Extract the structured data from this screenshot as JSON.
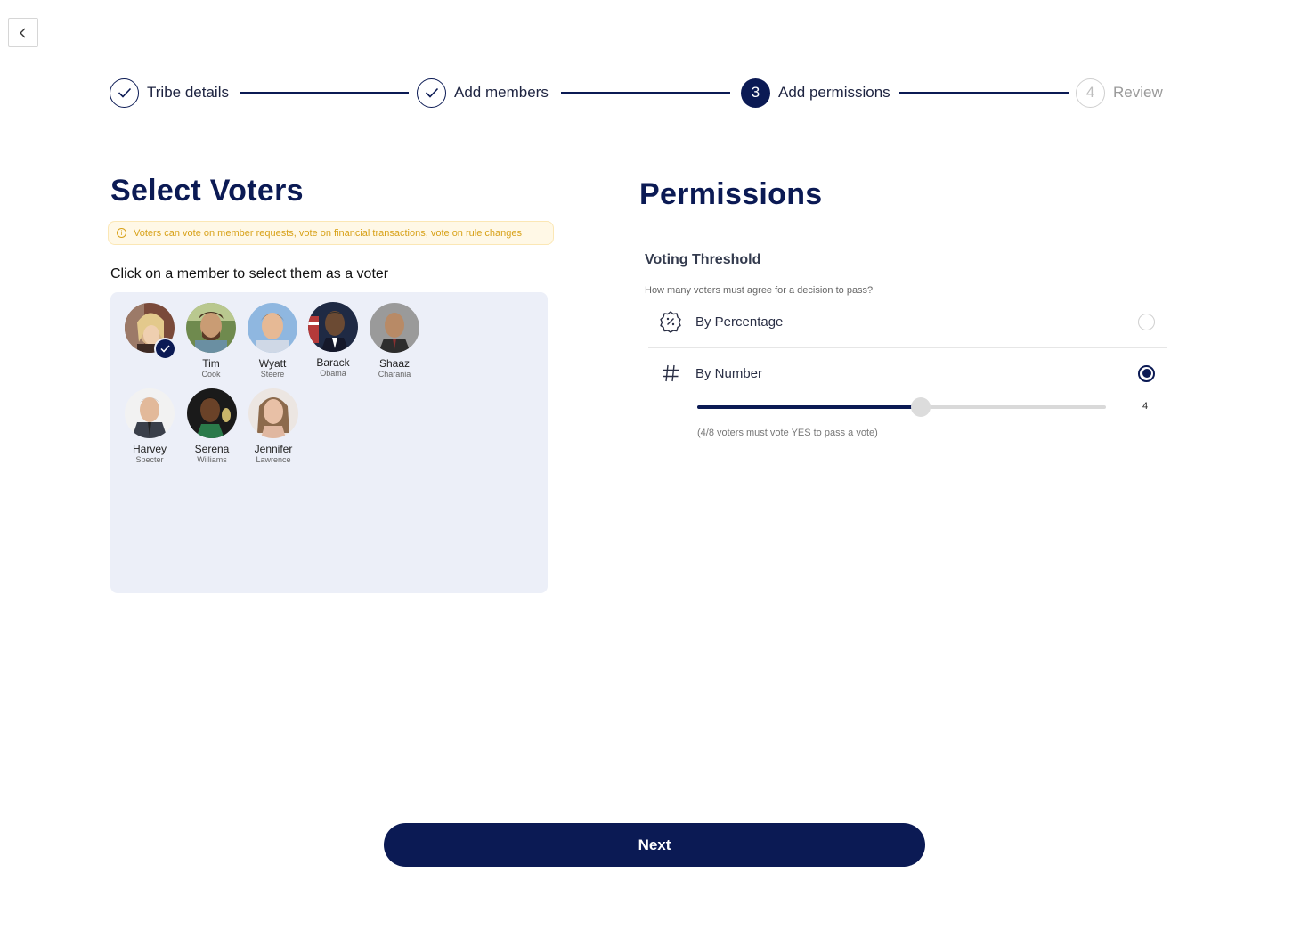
{
  "nav": {
    "back_icon": "chevron-left-icon"
  },
  "stepper": {
    "steps": [
      {
        "label": "Tribe details",
        "state": "done",
        "icon": "check-icon"
      },
      {
        "label": "Add members",
        "state": "done",
        "icon": "check-icon"
      },
      {
        "label": "Add permissions",
        "state": "active",
        "number": "3"
      },
      {
        "label": "Review",
        "state": "pending",
        "number": "4"
      }
    ]
  },
  "voters": {
    "title": "Select Voters",
    "notice": "Voters can vote on member requests, vote on financial transactions, vote on rule changes",
    "instruction": "Click on a member to select them as a voter",
    "members": [
      {
        "first": "",
        "last": "",
        "selected": true
      },
      {
        "first": "Tim",
        "last": "Cook",
        "selected": false
      },
      {
        "first": "Wyatt",
        "last": "Steere",
        "selected": false
      },
      {
        "first": "Barack",
        "last": "Obama",
        "selected": false
      },
      {
        "first": "Shaaz",
        "last": "Charania",
        "selected": false
      },
      {
        "first": "Harvey",
        "last": "Specter",
        "selected": false
      },
      {
        "first": "Serena",
        "last": "Williams",
        "selected": false
      },
      {
        "first": "Jennifer",
        "last": "Lawrence",
        "selected": false
      }
    ]
  },
  "permissions": {
    "title": "Permissions",
    "threshold_title": "Voting Threshold",
    "threshold_question": "How many voters must agree for a decision to pass?",
    "options": [
      {
        "label": "By Percentage",
        "icon": "percent-badge-icon",
        "selected": false
      },
      {
        "label": "By Number",
        "icon": "hash-icon",
        "selected": true
      }
    ],
    "slider": {
      "value": "4",
      "min": 0,
      "max": 8,
      "fraction": 0.546,
      "caption": "(4/8 voters must vote YES to pass a vote)"
    }
  },
  "footer": {
    "next_label": "Next"
  },
  "colors": {
    "primary": "#0b1a54",
    "notice_text": "#d8a21a",
    "panel_bg": "#eceff8"
  }
}
